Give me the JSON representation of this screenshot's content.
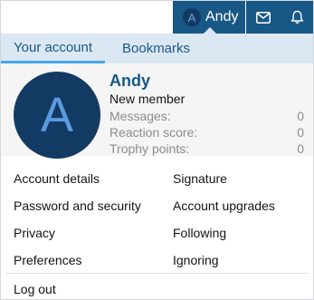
{
  "navbar": {
    "avatar_letter": "A",
    "username": "Andy",
    "icons": [
      "envelope-icon",
      "bell-icon"
    ]
  },
  "tabs": [
    {
      "label": "Your account",
      "active": true
    },
    {
      "label": "Bookmarks",
      "active": false
    }
  ],
  "profile": {
    "avatar_letter": "A",
    "name": "Andy",
    "user_title": "New member",
    "stats": [
      {
        "label": "Messages:",
        "value": "0"
      },
      {
        "label": "Reaction score:",
        "value": "0"
      },
      {
        "label": "Trophy points:",
        "value": "0"
      }
    ]
  },
  "menu": {
    "left": [
      "Account details",
      "Password and security",
      "Privacy",
      "Preferences"
    ],
    "right": [
      "Signature",
      "Account upgrades",
      "Following",
      "Ignoring"
    ],
    "logout": "Log out"
  },
  "colors": {
    "nav_bg": "#185886",
    "tab_bg": "#dbe8f4",
    "accent": "#47a7eb",
    "avatar_bg": "#123a63",
    "link_blue": "#185886"
  }
}
